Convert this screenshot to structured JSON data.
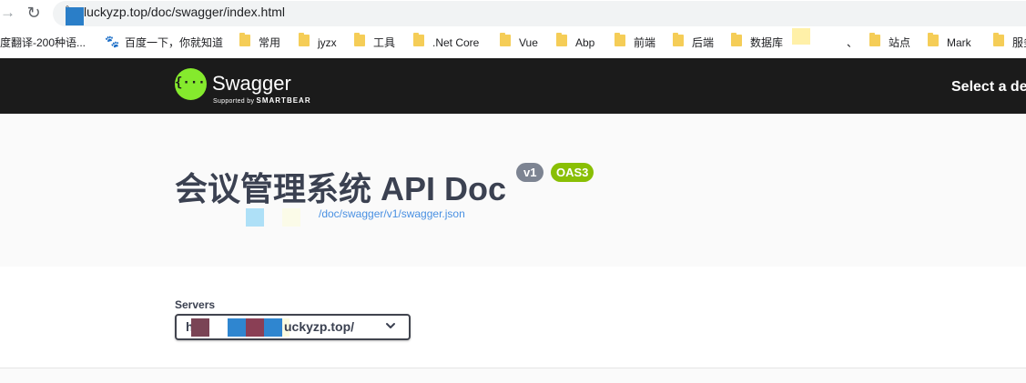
{
  "browser": {
    "url": "luckyzp.top/doc/swagger/index.html",
    "bookmarks": [
      {
        "label": "度翻译-200种语...",
        "icon": "none"
      },
      {
        "label": "百度一下，你就知道",
        "icon": "baidu-paw-icon"
      },
      {
        "label": "常用",
        "icon": "folder-icon"
      },
      {
        "label": "jyzx",
        "icon": "folder-icon"
      },
      {
        "label": "工具",
        "icon": "folder-icon"
      },
      {
        "label": ".Net Core",
        "icon": "folder-icon"
      },
      {
        "label": "Vue",
        "icon": "folder-icon"
      },
      {
        "label": "Abp",
        "icon": "folder-icon"
      },
      {
        "label": "前端",
        "icon": "folder-icon"
      },
      {
        "label": "后端",
        "icon": "folder-icon"
      },
      {
        "label": "数据库",
        "icon": "folder-icon"
      },
      {
        "label": "、",
        "icon": "none"
      },
      {
        "label": "站点",
        "icon": "folder-icon"
      },
      {
        "label": "Mark",
        "icon": "folder-icon"
      },
      {
        "label": "服务",
        "icon": "folder-icon"
      }
    ]
  },
  "topbar": {
    "logo_title": "Swagger",
    "logo_sub_prefix": "Supported by",
    "logo_sub_brand": "SMARTBEAR",
    "select_definition": "Select a de"
  },
  "info": {
    "title": "会议管理系统 API Doc",
    "version_badge": "v1",
    "oas_badge": "OAS3",
    "spec_url": "/doc/swagger/v1/swagger.json"
  },
  "servers": {
    "label": "Servers",
    "selected_prefix": "h",
    "selected_suffix": "uckyzp.top/"
  },
  "colors": {
    "topbar_bg": "#1b1b1b",
    "swagger_green": "#85ea2d",
    "oas_badge": "#89bf04",
    "version_badge": "#7d8492",
    "link": "#4990e2",
    "title_text": "#3b4151"
  }
}
